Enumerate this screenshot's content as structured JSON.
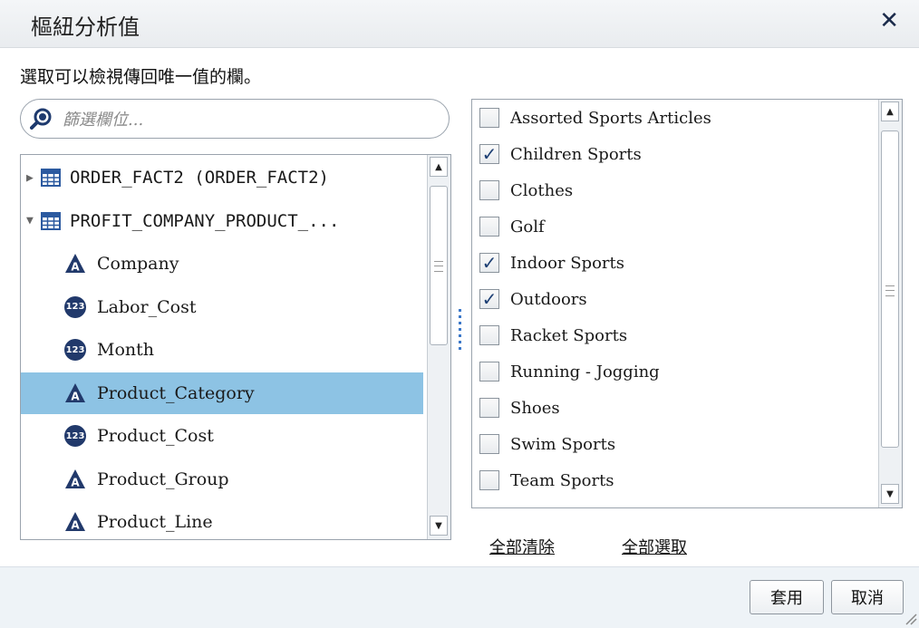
{
  "dialog": {
    "title": "樞紐分析值",
    "close_label": "✕",
    "instruction": "選取可以檢視傳回唯一值的欄。"
  },
  "search": {
    "placeholder": "篩選欄位..."
  },
  "tree": {
    "items": [
      {
        "label": "ORDER_FACT2 (ORDER_FACT2)",
        "kind": "table",
        "expanded": false
      },
      {
        "label": "PROFIT_COMPANY_PRODUCT_...",
        "kind": "table",
        "expanded": true
      },
      {
        "label": "Company",
        "kind": "category"
      },
      {
        "label": "Labor_Cost",
        "kind": "measure"
      },
      {
        "label": "Month",
        "kind": "measure"
      },
      {
        "label": "Product_Category",
        "kind": "category",
        "selected": true
      },
      {
        "label": "Product_Cost",
        "kind": "measure"
      },
      {
        "label": "Product_Group",
        "kind": "category"
      },
      {
        "label": "Product_Line",
        "kind": "category"
      }
    ],
    "measure_badge": "123"
  },
  "values": {
    "items": [
      {
        "label": "Assorted Sports Articles",
        "checked": false
      },
      {
        "label": "Children Sports",
        "checked": true
      },
      {
        "label": "Clothes",
        "checked": false
      },
      {
        "label": "Golf",
        "checked": false
      },
      {
        "label": "Indoor Sports",
        "checked": true
      },
      {
        "label": "Outdoors",
        "checked": true
      },
      {
        "label": "Racket Sports",
        "checked": false
      },
      {
        "label": "Running - Jogging",
        "checked": false
      },
      {
        "label": "Shoes",
        "checked": false
      },
      {
        "label": "Swim Sports",
        "checked": false
      },
      {
        "label": "Team Sports",
        "checked": false
      }
    ],
    "check_glyph": "✓"
  },
  "actions": {
    "clear_all": "全部清除",
    "select_all": "全部選取",
    "apply": "套用",
    "cancel": "取消"
  },
  "colors": {
    "selected_row": "#8dc3e4",
    "icon_navy": "#21396b",
    "accent_blue": "#3b78c9"
  }
}
